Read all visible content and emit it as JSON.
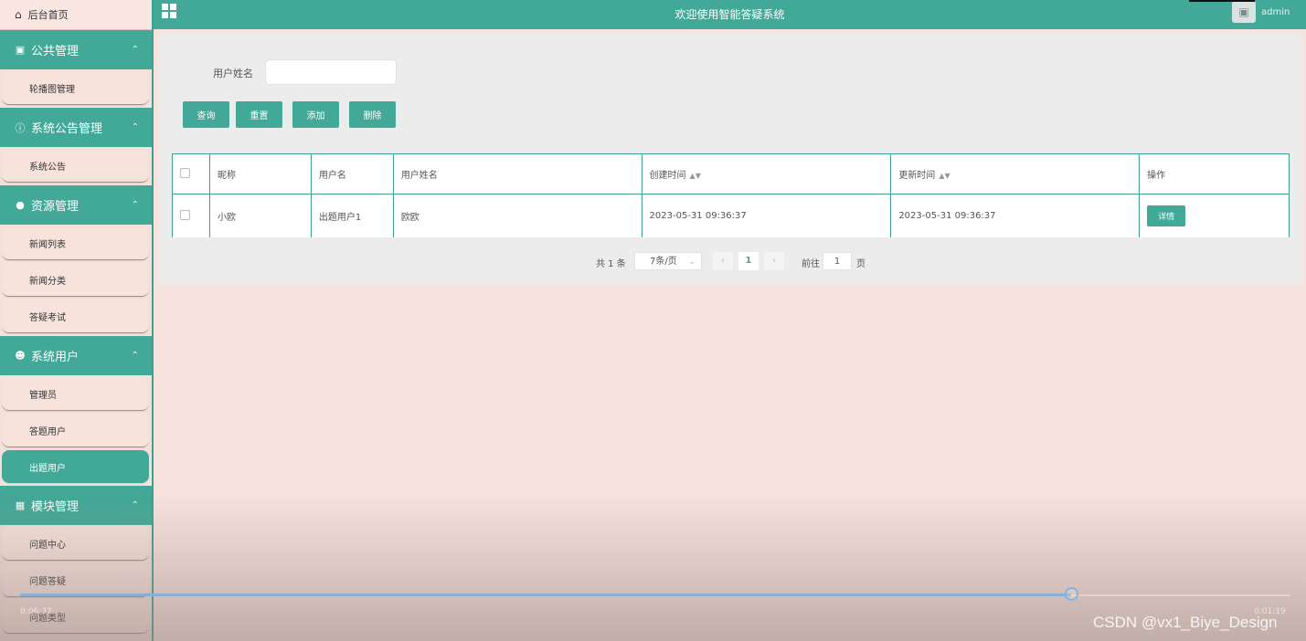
{
  "sidebar": {
    "home": "后台首页",
    "groups": [
      {
        "title": "公共管理",
        "icon": "image-icon",
        "items": [
          "轮播图管理"
        ]
      },
      {
        "title": "系统公告管理",
        "icon": "info-circle-icon",
        "items": [
          "系统公告"
        ]
      },
      {
        "title": "资源管理",
        "icon": "lightbulb-icon",
        "items": [
          "新闻列表",
          "新闻分类",
          "答疑考试"
        ]
      },
      {
        "title": "系统用户",
        "icon": "user-icon",
        "items": [
          "管理员",
          "答题用户",
          "出题用户"
        ]
      },
      {
        "title": "模块管理",
        "icon": "grid-icon",
        "items": [
          "问题中心",
          "问题答疑",
          "问题类型"
        ]
      }
    ],
    "active_item": "出题用户"
  },
  "header": {
    "title": "欢迎使用智能答疑系统",
    "username": "admin"
  },
  "search": {
    "label": "用户姓名",
    "value": "",
    "placeholder": ""
  },
  "buttons": {
    "query": "查询",
    "reset": "重置",
    "add": "添加",
    "delete": "删除"
  },
  "table": {
    "columns": [
      "昵称",
      "用户名",
      "用户姓名",
      "创建时间",
      "更新时间",
      "操作"
    ],
    "rows": [
      {
        "nickname": "小欧",
        "username": "出题用户1",
        "realname": "欧欧",
        "created": "2023-05-31 09:36:37",
        "updated": "2023-05-31 09:36:37",
        "action": "详情"
      }
    ]
  },
  "pagination": {
    "total": "共 1 条",
    "page_size": "7条/页",
    "current_page": "1",
    "goto_label": "前往",
    "goto_value": "1",
    "page_unit": "页"
  },
  "video": {
    "progress": 0.827,
    "elapsed": "0:06:37",
    "duration": "0:01:19"
  },
  "watermark": "CSDN @vx1_Biye_Design",
  "colors": {
    "accent": "#42a897",
    "background": "#f6e3dd",
    "panel": "#ececec"
  }
}
